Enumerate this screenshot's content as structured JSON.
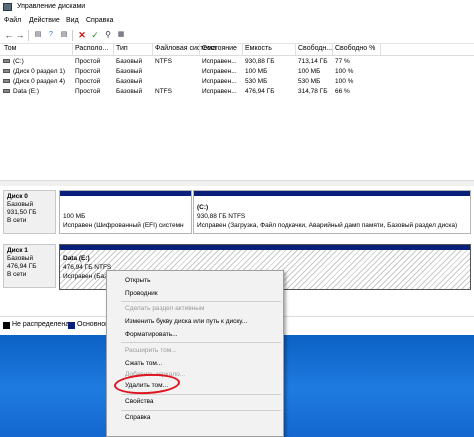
{
  "window": {
    "title": "Управление дисками"
  },
  "menu": {
    "items": [
      "Файл",
      "Действие",
      "Вид",
      "Справка"
    ]
  },
  "toolbar": {
    "icons": [
      "back-icon",
      "forward-icon",
      "list-view-icon",
      "help-icon",
      "list-icon",
      "delete-icon",
      "check-icon",
      "search-icon",
      "properties-icon"
    ]
  },
  "volumes": {
    "headers": [
      "Том",
      "Располо...",
      "Тип",
      "Файловая система",
      "Состояние",
      "Емкость",
      "Свободн...",
      "Свободно %"
    ],
    "rows": [
      [
        "(C:)",
        "Простой",
        "Базовый",
        "NTFS",
        "Исправен...",
        "930,88 ГБ",
        "713,14 ГБ",
        "77 %"
      ],
      [
        "(Диск 0 раздел 1)",
        "Простой",
        "Базовый",
        "",
        "Исправен...",
        "100 МБ",
        "100 МБ",
        "100 %"
      ],
      [
        "(Диск 0 раздел 4)",
        "Простой",
        "Базовый",
        "",
        "Исправен...",
        "530 МБ",
        "530 МБ",
        "100 %"
      ],
      [
        "Data (E:)",
        "Простой",
        "Базовый",
        "NTFS",
        "Исправен...",
        "476,94 ГБ",
        "314,78 ГБ",
        "66 %"
      ]
    ]
  },
  "disks": [
    {
      "name": "Диск 0",
      "type": "Базовый",
      "size": "931,50 ГБ",
      "status": "В сети",
      "partitions": [
        {
          "size": "100 МБ",
          "status": "Исправен (Шифрованный (EFI) системн"
        },
        {
          "name": "(C:)",
          "size": "930,88 ГБ NTFS",
          "status": "Исправен (Загрузка, Файл подкачки, Аварийный дамп памяти, Базовый раздел диска)"
        }
      ]
    },
    {
      "name": "Диск 1",
      "type": "Базовый",
      "size": "476,94 ГБ",
      "status": "В сети",
      "partitions": [
        {
          "name": "Data (E:)",
          "size": "476,94 ГБ NTFS",
          "status": "Исправен (Базов"
        }
      ]
    }
  ],
  "legend": [
    {
      "label": "Не распределена",
      "color": "#000000"
    },
    {
      "label": "Основной",
      "color": "#0a1f7a"
    }
  ],
  "context_menu": {
    "items": [
      {
        "label": "Открыть",
        "enabled": true
      },
      {
        "label": "Проводник",
        "enabled": true
      },
      {
        "label": "Сделать раздел активным",
        "enabled": false
      },
      {
        "label": "Изменить букву диска или путь к диску...",
        "enabled": true
      },
      {
        "label": "Форматировать...",
        "enabled": true
      },
      {
        "label": "Расширить том...",
        "enabled": false
      },
      {
        "label": "Сжать том...",
        "enabled": true
      },
      {
        "label": "Добавить зеркало...",
        "enabled": false
      },
      {
        "label": "Удалить том...",
        "enabled": true
      },
      {
        "label": "Свойства",
        "enabled": true
      },
      {
        "label": "Справка",
        "enabled": true
      }
    ]
  },
  "colors": {
    "accent": "#0a1f7a",
    "highlight_circle": "#e0141e"
  }
}
